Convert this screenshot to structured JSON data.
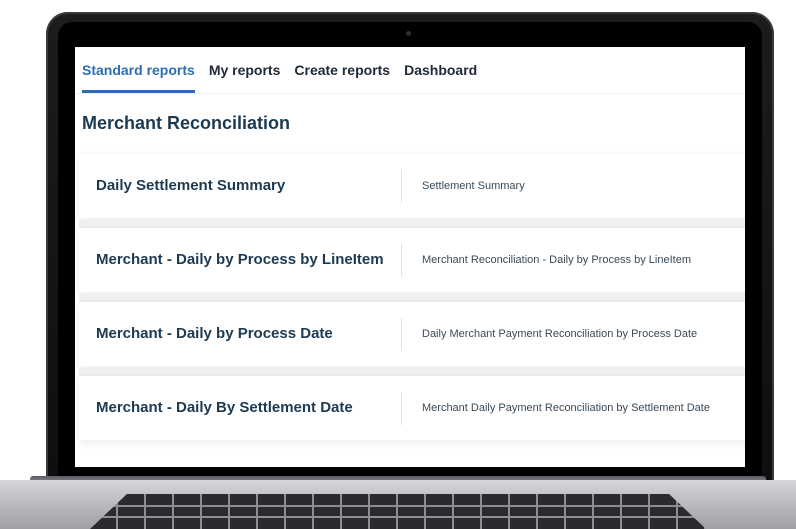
{
  "tabs": [
    {
      "label": "Standard reports",
      "active": true
    },
    {
      "label": "My reports",
      "active": false
    },
    {
      "label": "Create reports",
      "active": false
    },
    {
      "label": "Dashboard",
      "active": false
    }
  ],
  "section_title": "Merchant Reconciliation",
  "reports": [
    {
      "name": "Daily Settlement Summary",
      "description": "Settlement Summary"
    },
    {
      "name": "Merchant - Daily by Process by LineItem",
      "description": "Merchant Reconciliation - Daily by Process by LineItem"
    },
    {
      "name": "Merchant - Daily by Process Date",
      "description": "Daily Merchant Payment Reconciliation by Process Date"
    },
    {
      "name": "Merchant - Daily By Settlement Date",
      "description": "Merchant Daily Payment Reconciliation by Settlement Date"
    }
  ],
  "colors": {
    "accent": "#2e6db4",
    "heading": "#1c3a52",
    "bezel": "#141416"
  }
}
